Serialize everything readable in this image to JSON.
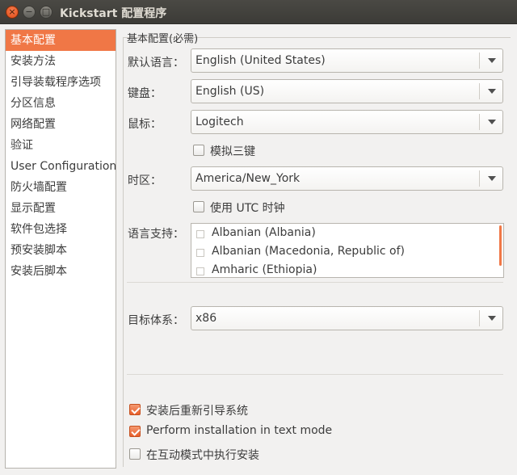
{
  "window": {
    "title": "Kickstart 配置程序",
    "close_glyph": "×",
    "minimize_glyph": "−",
    "maximize_glyph": "□"
  },
  "sidebar": {
    "items": [
      {
        "label": "基本配置",
        "selected": true
      },
      {
        "label": "安装方法"
      },
      {
        "label": "引导装载程序选项"
      },
      {
        "label": "分区信息"
      },
      {
        "label": "网络配置"
      },
      {
        "label": "验证"
      },
      {
        "label": "User Configuration"
      },
      {
        "label": "防火墙配置"
      },
      {
        "label": "显示配置"
      },
      {
        "label": "软件包选择"
      },
      {
        "label": "预安装脚本"
      },
      {
        "label": "安装后脚本"
      }
    ]
  },
  "basic": {
    "group_label": "基本配置(必需)",
    "language_label": "默认语言：",
    "language_value": "English (United States)",
    "keyboard_label": "键盘：",
    "keyboard_value": "English (US)",
    "mouse_label": "鼠标：",
    "mouse_value": "Logitech",
    "emulate3_label": "模拟三键",
    "emulate3_checked": false,
    "timezone_label": "时区：",
    "timezone_value": "America/New_York",
    "utc_label": "使用 UTC 时钟",
    "utc_checked": false,
    "langsupport_label": "语言支持：",
    "langsupport_items": [
      {
        "label": "Albanian (Albania)",
        "checked": false
      },
      {
        "label": "Albanian (Macedonia, Republic of)",
        "checked": false
      },
      {
        "label": "Amharic (Ethiopia)",
        "checked": false
      }
    ],
    "arch_label": "目标体系：",
    "arch_value": "x86",
    "reboot_label": "安装后重新引导系统",
    "reboot_checked": true,
    "textmode_label": "Perform installation in text mode",
    "textmode_checked": true,
    "interactive_label": "在互动模式中执行安装",
    "interactive_checked": false
  },
  "colors": {
    "accent": "#f07746",
    "titlebar": "#3c3b37",
    "background": "#f2f1f0"
  }
}
